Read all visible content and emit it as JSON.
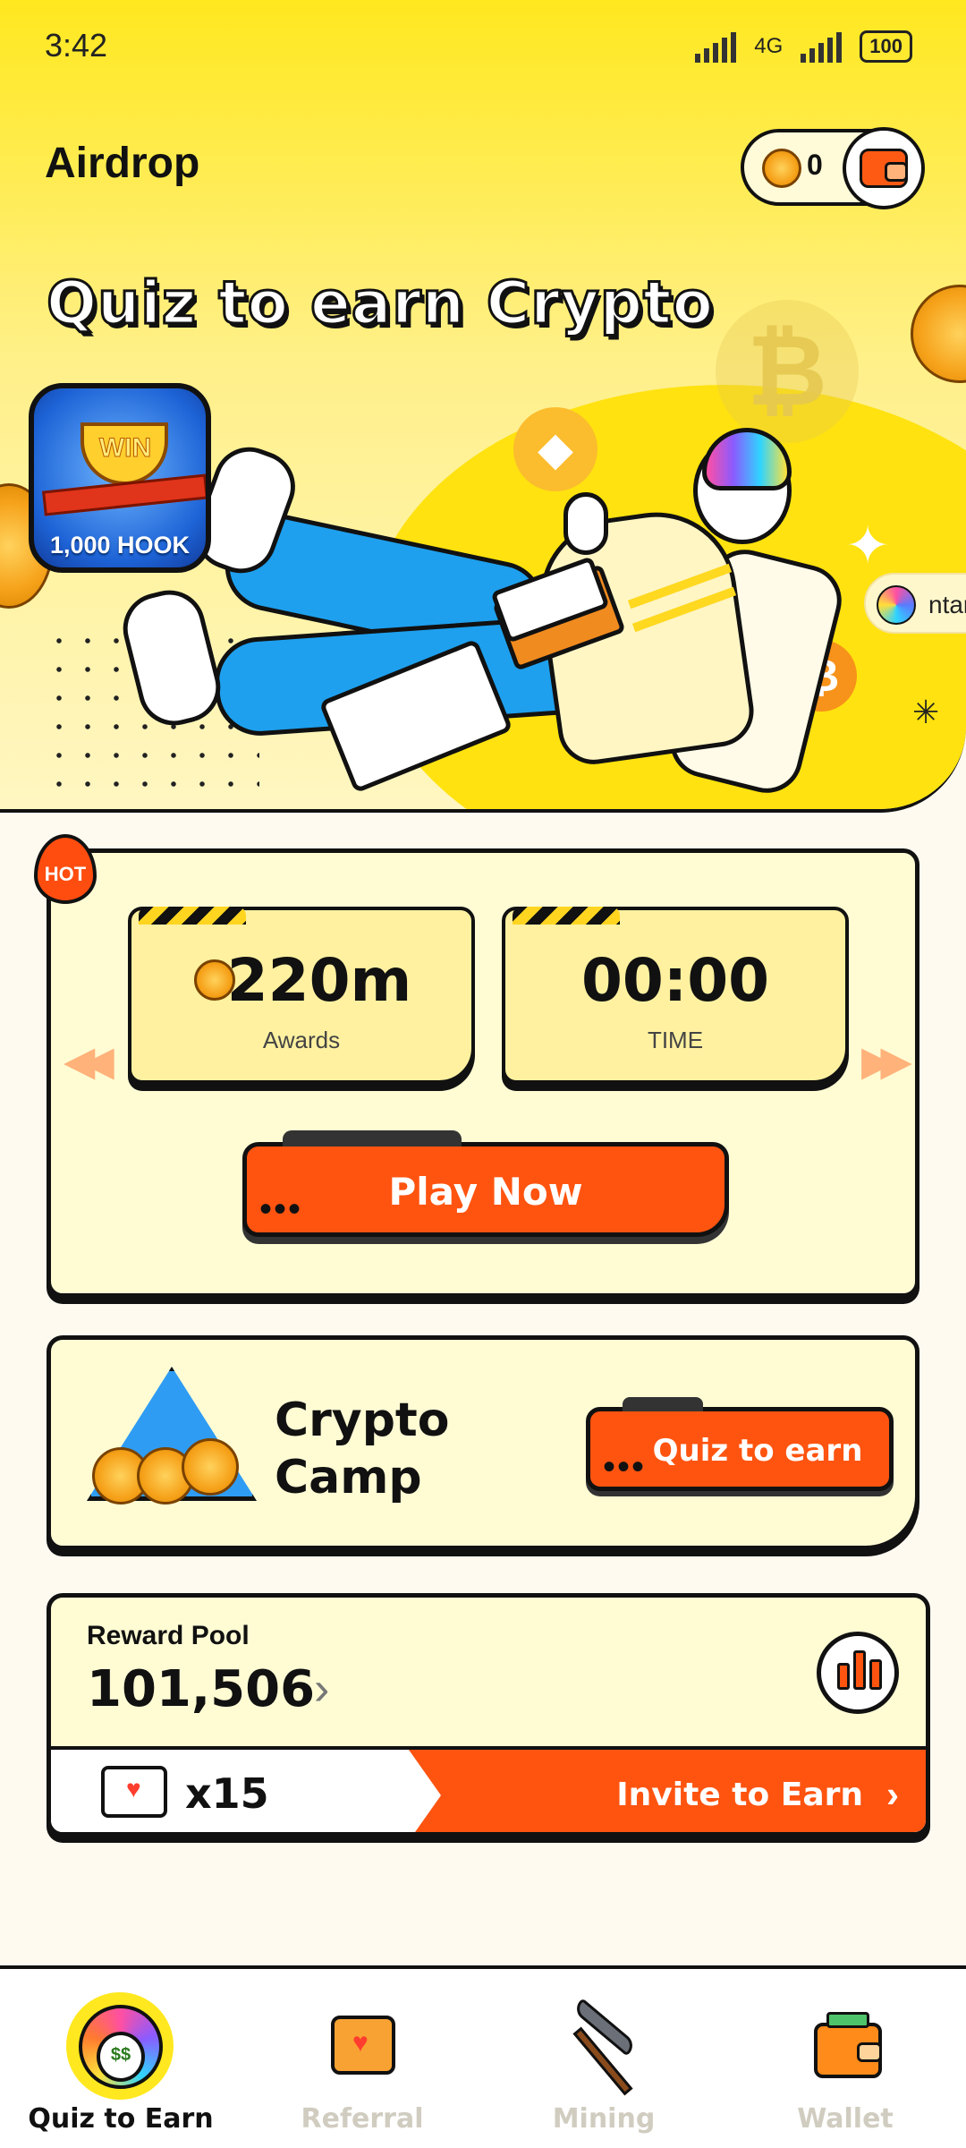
{
  "status_bar": {
    "time": "3:42",
    "network": "4G",
    "battery": "100"
  },
  "header": {
    "title": "Airdrop",
    "coin_count": "0"
  },
  "hero": {
    "title": "Quiz to earn Crypto",
    "prize_badge": {
      "banner": "WIN",
      "label": "1,000 HOOK"
    },
    "ticker_text": "ntar"
  },
  "quiz_card": {
    "hot_badge": "HOT",
    "awards": {
      "value": "220m",
      "label": "Awards"
    },
    "time": {
      "value": "00:00",
      "label": "TIME"
    },
    "play_button": "Play Now"
  },
  "camp_card": {
    "title": "Crypto Camp",
    "button": "Quiz to earn"
  },
  "reward_pool": {
    "label": "Reward Pool",
    "value": "101,506",
    "invite_count": "x15",
    "invite_button": "Invite to Earn"
  },
  "bottom_nav": {
    "items": [
      {
        "label": "Quiz to Earn",
        "icon": "avatar-icon",
        "active": true
      },
      {
        "label": "Referral",
        "icon": "envelope-heart-icon",
        "active": false
      },
      {
        "label": "Mining",
        "icon": "pickaxe-icon",
        "active": false
      },
      {
        "label": "Wallet",
        "icon": "wallet-icon",
        "active": false
      }
    ]
  },
  "colors": {
    "accent": "#ff5410",
    "hero_yellow": "#ffe81f",
    "card_bg": "#fffcd4",
    "coin_gold": "#f6a21a"
  }
}
